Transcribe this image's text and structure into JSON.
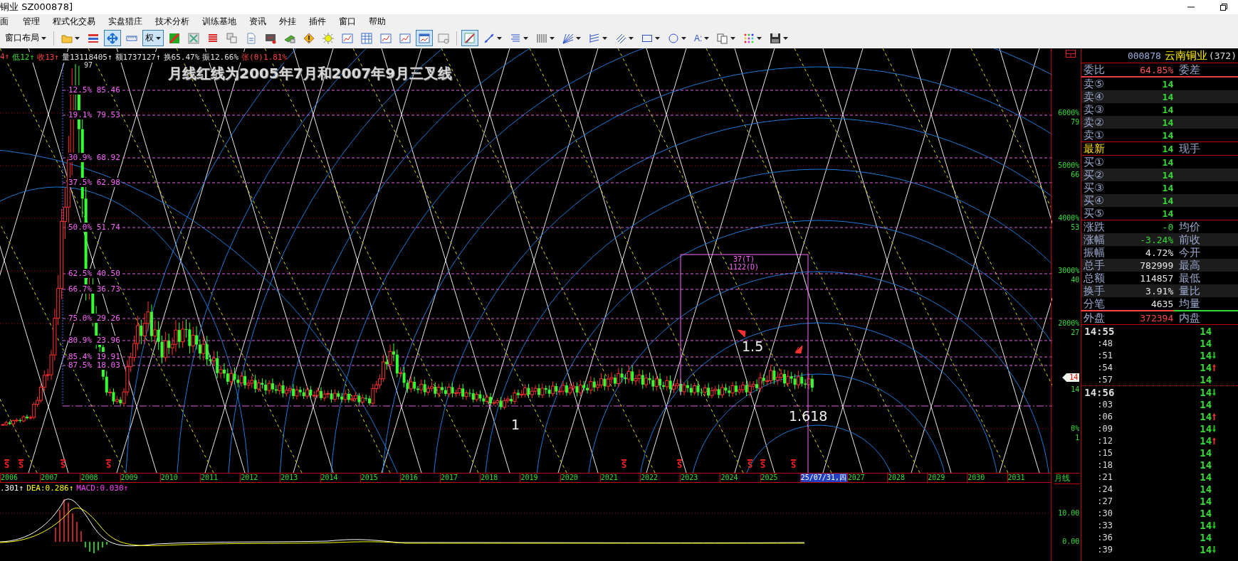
{
  "window": {
    "title": "铜业 SZ000878]"
  },
  "menu": [
    "面",
    "管理",
    "程式化交易",
    "实盘猎庄",
    "技术分析",
    "训练基地",
    "资讯",
    "外挂",
    "插件",
    "窗口",
    "帮助"
  ],
  "toolbar": {
    "items": [
      {
        "kind": "layout",
        "label": "窗口布局",
        "dropdown": true,
        "selected": false
      },
      {
        "kind": "separator"
      },
      {
        "kind": "folder",
        "dropdown": true,
        "selected": false
      },
      {
        "kind": "barlist",
        "dropdown": false,
        "selected": false
      },
      {
        "kind": "cross",
        "dropdown": false,
        "selected": true
      },
      {
        "kind": "ruler",
        "dropdown": false,
        "selected": false
      },
      {
        "kind": "quan",
        "label": "权",
        "dropdown": true,
        "selected": true
      },
      {
        "kind": "greenred",
        "dropdown": false,
        "selected": false
      },
      {
        "kind": "grayx",
        "dropdown": false,
        "selected": false
      },
      {
        "kind": "redlist",
        "dropdown": false,
        "selected": false
      },
      {
        "kind": "copywin",
        "dropdown": false,
        "selected": false
      },
      {
        "kind": "doc",
        "dropdown": false,
        "selected": false
      },
      {
        "kind": "monitor",
        "dropdown": false,
        "selected": false
      },
      {
        "kind": "money",
        "dropdown": false,
        "selected": false
      },
      {
        "kind": "warning",
        "dropdown": false,
        "selected": false
      },
      {
        "kind": "gear",
        "dropdown": false,
        "selected": false
      },
      {
        "kind": "chartline",
        "dropdown": false,
        "selected": false
      },
      {
        "kind": "table",
        "dropdown": false,
        "selected": false
      },
      {
        "kind": "chartline",
        "dropdown": false,
        "selected": false
      },
      {
        "kind": "chartline",
        "dropdown": false,
        "selected": false
      },
      {
        "kind": "chartwin",
        "dropdown": false,
        "selected": true
      },
      {
        "kind": "screen",
        "dropdown": false,
        "selected": false
      },
      {
        "kind": "separator"
      },
      {
        "kind": "drawtool",
        "dropdown": false,
        "selected": true
      },
      {
        "kind": "line",
        "dropdown": true,
        "selected": false
      },
      {
        "kind": "fib",
        "dropdown": true,
        "selected": false
      },
      {
        "kind": "vlines",
        "dropdown": true,
        "selected": false
      },
      {
        "kind": "fan",
        "dropdown": true,
        "selected": false
      },
      {
        "kind": "parallel",
        "dropdown": true,
        "selected": false
      },
      {
        "kind": "diag",
        "dropdown": true,
        "selected": false
      },
      {
        "kind": "rect",
        "dropdown": true,
        "selected": false
      },
      {
        "kind": "circle",
        "dropdown": true,
        "selected": false
      },
      {
        "kind": "texttool",
        "label": "A:",
        "dropdown": true,
        "selected": false
      },
      {
        "kind": "copy",
        "dropdown": true,
        "selected": false
      },
      {
        "kind": "palette",
        "dropdown": true,
        "selected": false
      },
      {
        "kind": "save",
        "dropdown": true,
        "selected": false
      }
    ]
  },
  "chart": {
    "info": [
      {
        "text": "4↑",
        "color": "#ff4040"
      },
      {
        "text": "低12↑",
        "color": "#33dd33"
      },
      {
        "text": "收13↑",
        "color": "#ff4040"
      },
      {
        "text": "量13118405↑",
        "color": "#e0e0e0"
      },
      {
        "text": "额1737127↑",
        "color": "#e0e0e0"
      },
      {
        "text": "换65.47%",
        "color": "#e0e0e0"
      },
      {
        "text": "振12.66%",
        "color": "#e0e0e0"
      },
      {
        "text": "张(0)1.81%",
        "color": "#ff4040"
      }
    ],
    "title": "月线红线为2005年7月和2007年9月三叉线",
    "peak_label": "97",
    "fib_labels": [
      "12.5% 85.46",
      "19.1% 79.53",
      "30.9% 68.92",
      "37.5% 62.98",
      "50.0% 51.74",
      "62.5% 40.50",
      "66.7% 36.73",
      "75.0% 29.26",
      "80.9% 23.96",
      "85.4% 19.91",
      "87.5% 18.03"
    ],
    "cycle_box": {
      "top": "37(T)",
      "bottom": "1122(D)"
    },
    "annotations": [
      "1.5",
      "1",
      "1.618"
    ],
    "signal_marks": [
      "S",
      "S",
      "S",
      "S",
      "S",
      "S",
      "S",
      "S",
      "S"
    ],
    "time_axis": [
      {
        "kind": "year",
        "label": "2006"
      },
      {
        "kind": "year",
        "label": "2007"
      },
      {
        "kind": "year",
        "label": "2008"
      },
      {
        "kind": "year",
        "label": "2009"
      },
      {
        "kind": "year",
        "label": "2010"
      },
      {
        "kind": "year",
        "label": "2011"
      },
      {
        "kind": "year",
        "label": "2012"
      },
      {
        "kind": "year",
        "label": "2013"
      },
      {
        "kind": "year",
        "label": "2014"
      },
      {
        "kind": "year",
        "label": "2015"
      },
      {
        "kind": "year",
        "label": "2016"
      },
      {
        "kind": "year",
        "label": "2017"
      },
      {
        "kind": "year",
        "label": "2018"
      },
      {
        "kind": "year",
        "label": "2019"
      },
      {
        "kind": "year",
        "label": "2020"
      },
      {
        "kind": "year",
        "label": "2021"
      },
      {
        "kind": "year",
        "label": "2022"
      },
      {
        "kind": "year",
        "label": "2023"
      },
      {
        "kind": "year",
        "label": "2024"
      },
      {
        "kind": "year",
        "label": "2025"
      },
      {
        "kind": "cursor",
        "label": "25/07/31,四"
      },
      {
        "kind": "year",
        "label": "2027"
      },
      {
        "kind": "year",
        "label": "2028"
      },
      {
        "kind": "year",
        "label": "2029"
      },
      {
        "kind": "year",
        "label": "2030"
      },
      {
        "kind": "year",
        "label": "2031"
      }
    ],
    "macd_legend": [
      {
        "text": ".301↑",
        "color": "#ffffff"
      },
      {
        "text": "DEA:0.286↑",
        "color": "#ffff00"
      },
      {
        "text": "MACD:0.030↑",
        "color": "#ff40ff"
      }
    ]
  },
  "axis": {
    "ticks": [
      {
        "pct": "6000%",
        "price": "79"
      },
      {
        "pct": "5000%",
        "price": "66"
      },
      {
        "pct": "4000%",
        "price": "53"
      },
      {
        "pct": "3000%",
        "price": "40"
      },
      {
        "pct": "2000%",
        "price": "27"
      },
      {
        "pct": "0%",
        "price": "1"
      }
    ],
    "current_tag": "14",
    "current_price": "14",
    "period": "月线",
    "macd_ticks": [
      "10.00",
      "0.00"
    ]
  },
  "quote": {
    "code": "000878",
    "name": "云南铜业",
    "count": "(372)",
    "ratio": {
      "label": "委比",
      "value": "64.85%",
      "right_label": "委差"
    },
    "asks": [
      {
        "label": "卖⑤",
        "price": "14"
      },
      {
        "label": "卖④",
        "price": "14"
      },
      {
        "label": "卖③",
        "price": "14"
      },
      {
        "label": "卖②",
        "price": "14"
      },
      {
        "label": "卖①",
        "price": "14"
      }
    ],
    "last": {
      "label": "最新",
      "price": "14",
      "right_label": "现手"
    },
    "bids": [
      {
        "label": "买①",
        "price": "14"
      },
      {
        "label": "买②",
        "price": "14"
      },
      {
        "label": "买③",
        "price": "14"
      },
      {
        "label": "买④",
        "price": "14"
      },
      {
        "label": "买⑤",
        "price": "14"
      }
    ],
    "stats": [
      {
        "label": "涨跌",
        "value": "-0",
        "color": "#33dd33",
        "right_label": "均价"
      },
      {
        "label": "涨幅",
        "value": "-3.24%",
        "color": "#33dd33",
        "right_label": "前收"
      },
      {
        "label": "振幅",
        "value": "4.72%",
        "color": "#e8e8e8",
        "right_label": "今开"
      },
      {
        "label": "总手",
        "value": "782999",
        "color": "#e8e8e8",
        "right_label": "最高"
      },
      {
        "label": "总额",
        "value": "114857",
        "color": "#e8e8e8",
        "right_label": "最低"
      },
      {
        "label": "换手",
        "value": "3.91%",
        "color": "#e8e8e8",
        "right_label": "量比"
      },
      {
        "label": "分笔",
        "value": "4635",
        "color": "#e8e8e8",
        "right_label": "均量"
      }
    ],
    "ratio_bar": {
      "level": 0.59
    },
    "outer": {
      "label": "外盘",
      "value": "372394",
      "right_label": "内盘"
    }
  },
  "ticks": [
    {
      "time": "14:55",
      "kind": "minute",
      "price": "14",
      "uptick": false,
      "downtick": false
    },
    {
      "time": ":48",
      "kind": "tick",
      "price": "14",
      "uptick": false,
      "downtick": false
    },
    {
      "time": ":51",
      "kind": "tick",
      "price": "14",
      "uptick": false,
      "downtick": true
    },
    {
      "time": ":54",
      "kind": "tick",
      "price": "14",
      "uptick": true,
      "downtick": false
    },
    {
      "time": ":57",
      "kind": "tick",
      "price": "14",
      "uptick": false,
      "downtick": false
    },
    {
      "time": "14:56",
      "kind": "minute",
      "price": "14",
      "uptick": false,
      "downtick": true
    },
    {
      "time": ":03",
      "kind": "tick",
      "price": "14",
      "uptick": false,
      "downtick": false
    },
    {
      "time": ":06",
      "kind": "tick",
      "price": "14",
      "uptick": true,
      "downtick": false
    },
    {
      "time": ":09",
      "kind": "tick",
      "price": "14",
      "uptick": false,
      "downtick": true
    },
    {
      "time": ":12",
      "kind": "tick",
      "price": "14",
      "uptick": true,
      "downtick": false
    },
    {
      "time": ":15",
      "kind": "tick",
      "price": "14",
      "uptick": false,
      "downtick": false
    },
    {
      "time": ":18",
      "kind": "tick",
      "price": "14",
      "uptick": false,
      "downtick": false
    },
    {
      "time": ":21",
      "kind": "tick",
      "price": "14",
      "uptick": false,
      "downtick": false
    },
    {
      "time": ":24",
      "kind": "tick",
      "price": "14",
      "uptick": false,
      "downtick": false
    },
    {
      "time": ":27",
      "kind": "tick",
      "price": "14",
      "uptick": false,
      "downtick": false
    },
    {
      "time": ":30",
      "kind": "tick",
      "price": "14",
      "uptick": false,
      "downtick": false
    },
    {
      "time": ":33",
      "kind": "tick",
      "price": "14",
      "uptick": false,
      "downtick": true
    },
    {
      "time": ":36",
      "kind": "tick",
      "price": "14",
      "uptick": false,
      "downtick": false
    },
    {
      "time": ":39",
      "kind": "tick",
      "price": "14",
      "uptick": false,
      "downtick": true
    }
  ]
}
